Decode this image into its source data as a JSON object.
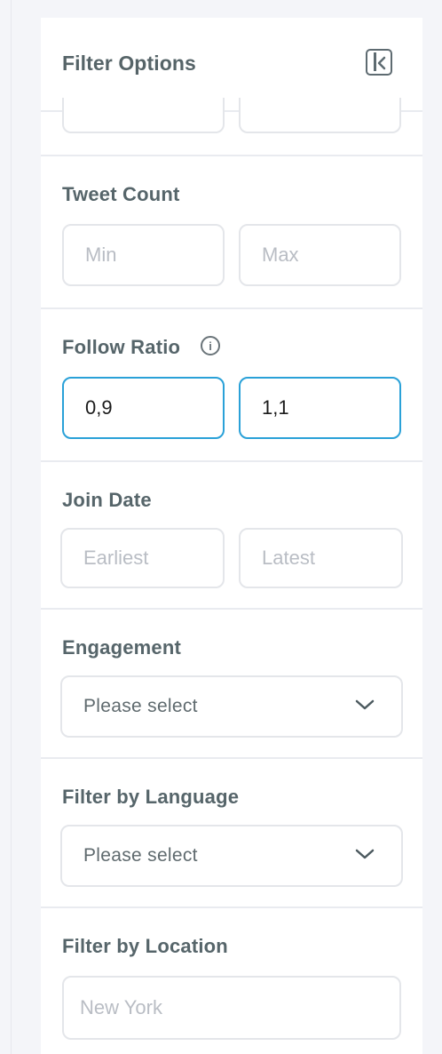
{
  "panel": {
    "title": "Filter Options"
  },
  "tweet_count": {
    "label": "Tweet Count",
    "min_placeholder": "Min",
    "max_placeholder": "Max"
  },
  "follow_ratio": {
    "label": "Follow Ratio",
    "min_value": "0,9",
    "max_value": "1,1",
    "info_glyph": "i"
  },
  "join_date": {
    "label": "Join Date",
    "earliest_placeholder": "Earliest",
    "latest_placeholder": "Latest"
  },
  "engagement": {
    "label": "Engagement",
    "selected": "Please select"
  },
  "language": {
    "label": "Filter by Language",
    "selected": "Please select"
  },
  "location": {
    "label": "Filter by Location",
    "placeholder": "New York"
  },
  "colors": {
    "accent_focus": "#2aa1d8",
    "label_text": "#56656a",
    "placeholder_text": "#b9bdc4"
  }
}
